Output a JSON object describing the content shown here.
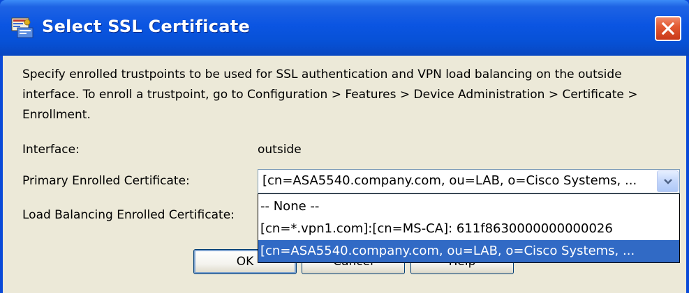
{
  "window": {
    "title": "Select SSL Certificate"
  },
  "description": "Specify enrolled trustpoints to be used for SSL authentication and VPN load balancing on the outside interface. To enroll a trustpoint, go to Configuration > Features > Device Administration > Certificate > Enrollment.",
  "form": {
    "interface_label": "Interface:",
    "interface_value": "outside",
    "primary_label": "Primary Enrolled Certificate:",
    "primary_value": "[cn=ASA5540.company.com, ou=LAB, o=Cisco Systems, ...",
    "load_balancing_label": "Load Balancing Enrolled Certificate:"
  },
  "dropdown": {
    "options": [
      "-- None --",
      "[cn=*.vpn1.com]:[cn=MS-CA]: 611f8630000000000026",
      "[cn=ASA5540.company.com, ou=LAB, o=Cisco Systems, ..."
    ],
    "selected_index": 2
  },
  "buttons": {
    "ok": "OK",
    "cancel": "Cancel",
    "help": "Help"
  },
  "colors": {
    "titlebar": "#0b55e2",
    "client_bg": "#ece9d8",
    "selection": "#316ac5",
    "close_button": "#e35a33"
  },
  "icons": {
    "title": "certificate-app-icon",
    "close": "close-x-icon",
    "combo": "chevron-down-icon"
  }
}
